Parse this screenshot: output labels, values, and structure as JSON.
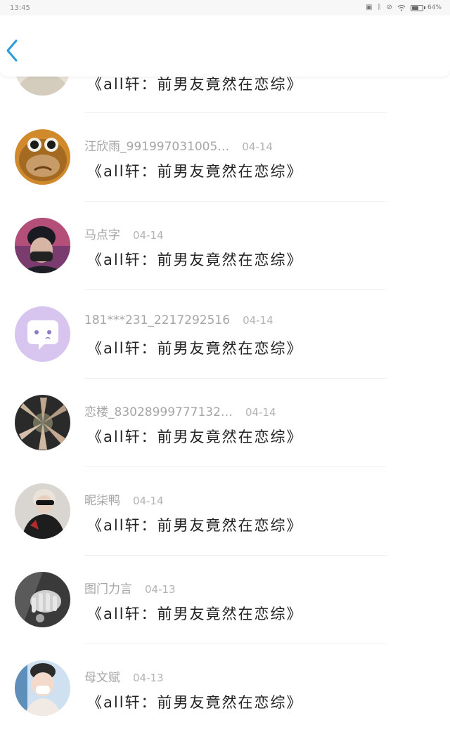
{
  "status_bar": {
    "time": "13:45",
    "battery_percent": "64%",
    "battery_level": 0.64,
    "icons": [
      "vibrate-icon",
      "bluetooth-icon",
      "mute-icon",
      "wifi-icon",
      "battery-icon"
    ]
  },
  "header": {
    "back_icon": "chevron-left-icon",
    "accent": "#2d9cdb"
  },
  "comments": [
    {
      "user": "",
      "date": "",
      "text": "《all轩：前男友竟然在恋综》",
      "avatar": "beige"
    },
    {
      "user": "汪欣雨_991997031005…",
      "date": "04-14",
      "text": "《all轩：前男友竟然在恋综》",
      "avatar": "monkey"
    },
    {
      "user": "马点字",
      "date": "04-14",
      "text": "《all轩：前男友竟然在恋综》",
      "avatar": "person-mask"
    },
    {
      "user": "181***231_2217292516",
      "date": "04-14",
      "text": "《all轩：前男友竟然在恋综》",
      "avatar": "purple-chat"
    },
    {
      "user": "恋楼_83028999777132…",
      "date": "04-14",
      "text": "《all轩：前男友竟然在恋综》",
      "avatar": "hands"
    },
    {
      "user": "昵柒鸭",
      "date": "04-14",
      "text": "《all轩：前男友竟然在恋综》",
      "avatar": "girl-sunglasses"
    },
    {
      "user": "图门力言",
      "date": "04-13",
      "text": "《all轩：前男友竟然在恋综》",
      "avatar": "dark-hand"
    },
    {
      "user": "母文赋",
      "date": "04-13",
      "text": "《all轩：前男友竟然在恋综》",
      "avatar": "baby"
    }
  ]
}
